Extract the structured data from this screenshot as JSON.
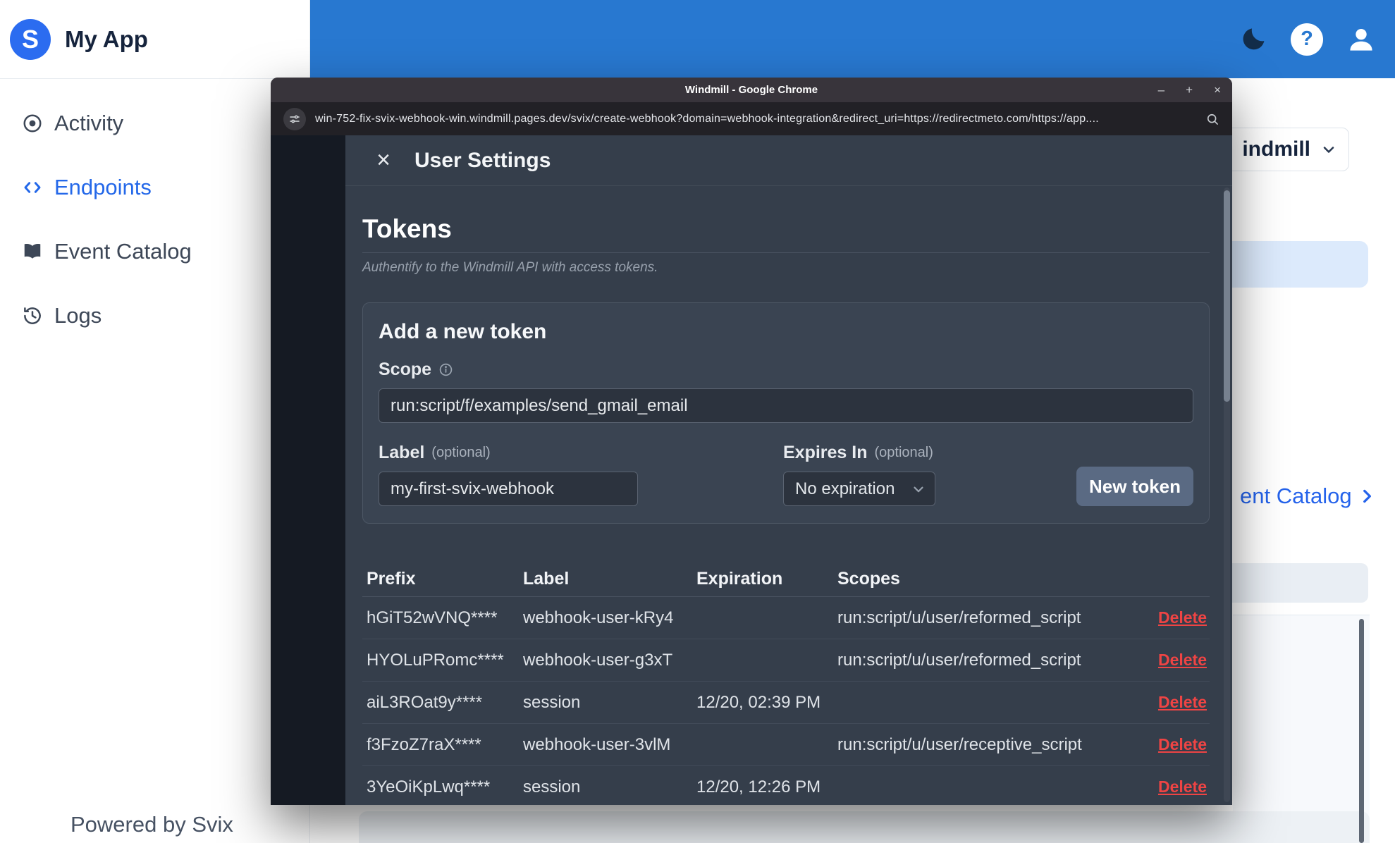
{
  "app": {
    "name": "My App",
    "powered_by": "Powered by Svix",
    "nav": [
      {
        "label": "Activity"
      },
      {
        "label": "Endpoints"
      },
      {
        "label": "Event Catalog"
      },
      {
        "label": "Logs"
      }
    ]
  },
  "topbar": {
    "help_glyph": "?"
  },
  "background_page": {
    "dropdown_value": "indmill",
    "catalog_link_text": "ent Catalog"
  },
  "chrome": {
    "title": "Windmill - Google Chrome",
    "controls": [
      "–",
      "+",
      "×"
    ],
    "url": "win-752-fix-svix-webhook-win.windmill.pages.dev/svix/create-webhook?domain=webhook-integration&redirect_uri=https://redirectmeto.com/https://app...."
  },
  "settings": {
    "title": "User Settings",
    "close_glyph": "×",
    "section_title": "Tokens",
    "section_subtitle": "Authentify to the Windmill API with access tokens.",
    "add_token": {
      "title": "Add a new token",
      "scope_label": "Scope",
      "scope_value": "run:script/f/examples/send_gmail_email",
      "label_label": "Label",
      "optional_hint": "(optional)",
      "label_value": "my-first-svix-webhook",
      "expires_label": "Expires In",
      "expires_value": "No expiration",
      "submit_label": "New token"
    },
    "table": {
      "headers": [
        "Prefix",
        "Label",
        "Expiration",
        "Scopes"
      ],
      "delete_label": "Delete",
      "rows": [
        {
          "prefix": "hGiT52wVNQ****",
          "label": "webhook-user-kRy4",
          "expiration": "",
          "scopes": "run:script/u/user/reformed_script"
        },
        {
          "prefix": "HYOLuPRomc****",
          "label": "webhook-user-g3xT",
          "expiration": "",
          "scopes": "run:script/u/user/reformed_script"
        },
        {
          "prefix": "aiL3ROat9y****",
          "label": "session",
          "expiration": "12/20, 02:39 PM",
          "scopes": ""
        },
        {
          "prefix": "f3FzoZ7raX****",
          "label": "webhook-user-3vlM",
          "expiration": "",
          "scopes": "run:script/u/user/receptive_script"
        },
        {
          "prefix": "3YeOiKpLwq****",
          "label": "session",
          "expiration": "12/20, 12:26 PM",
          "scopes": ""
        }
      ]
    }
  },
  "colors": {
    "topbar_blue": "#2878d0",
    "accent_blue": "#2563eb",
    "delete_red": "#ef4444",
    "panel_dark": "#353e4b",
    "button_slate": "#5a6a83",
    "sidebar_active": "#2468e9"
  }
}
